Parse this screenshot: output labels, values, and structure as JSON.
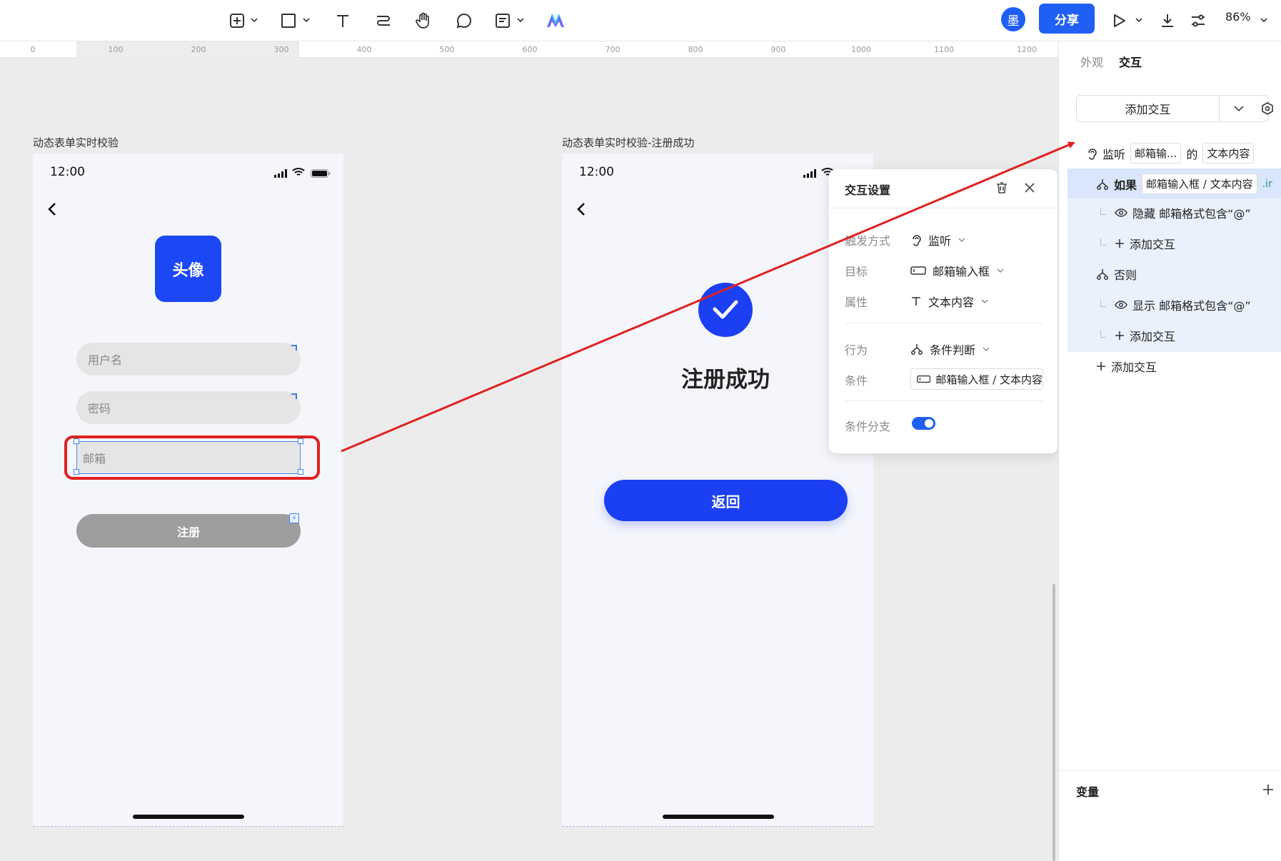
{
  "toolbar": {
    "tools": [
      "add-frame-icon",
      "rectangle-icon",
      "text-icon",
      "connector-icon",
      "hand-icon",
      "comment-icon",
      "note-icon",
      "ai-logo-icon"
    ],
    "user_avatar": "墨",
    "share_label": "分享",
    "zoom": "86%"
  },
  "ruler": {
    "ticks": [
      "0",
      "100",
      "200",
      "300",
      "400",
      "500",
      "600",
      "700",
      "800",
      "900",
      "1000",
      "1100",
      "1200"
    ]
  },
  "frame1": {
    "title": "动态表单实时校验",
    "time": "12:00",
    "avatar_label": "头像",
    "username_placeholder": "用户名",
    "password_placeholder": "密码",
    "email_placeholder": "邮箱",
    "register_label": "注册"
  },
  "frame2": {
    "title": "动态表单实时校验-注册成功",
    "time": "12:00",
    "success_title": "注册成功",
    "back_label": "返回"
  },
  "popup": {
    "title": "交互设置",
    "trigger_label": "触发方式",
    "trigger_value": "监听",
    "target_label": "目标",
    "target_value": "邮箱输入框",
    "property_label": "属性",
    "property_value": "文本内容",
    "action_label": "行为",
    "action_value": "条件判断",
    "condition_label": "条件",
    "condition_value": "邮箱输入框 / 文本内容",
    "branch_label": "条件分支",
    "branch_enabled": true
  },
  "panel": {
    "tab_appearance": "外观",
    "tab_interaction": "交互",
    "add_interaction": "添加交互",
    "listen_label": "监听",
    "listen_target": "邮箱输...",
    "listen_of": "的",
    "listen_property": "文本内容",
    "if_label": "如果",
    "if_condition": "邮箱输入框 / 文本内容",
    "if_suffix": ".ir",
    "hide_action": "隐藏 邮箱格式包含“@”",
    "add_interaction_child_1": "添加交互",
    "else_label": "否则",
    "show_action": "显示 邮箱格式包含“@”",
    "add_interaction_child_2": "添加交互",
    "add_interaction_root": "添加交互",
    "variables_label": "变量"
  },
  "colors": {
    "accent": "#1f5ff4",
    "annotation_red": "#e02020",
    "primary_button": "#1b3ff2"
  }
}
